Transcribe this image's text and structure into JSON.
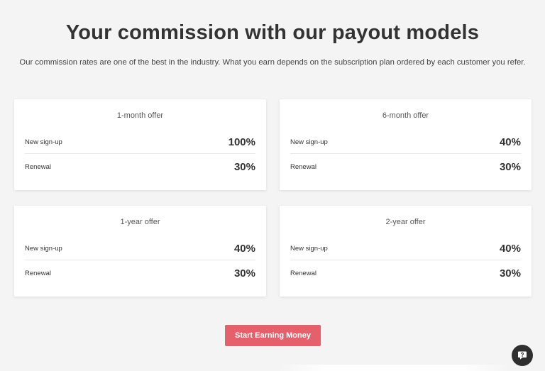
{
  "header": {
    "title": "Your commission with our payout models",
    "intro": "Our commission rates are one of the best in the industry. What you earn depends on the subscription plan ordered by each customer you refer."
  },
  "offers": [
    {
      "title": "1-month offer",
      "signup_label": "New sign-up",
      "signup_value": "100%",
      "renewal_label": "Renewal",
      "renewal_value": "30%"
    },
    {
      "title": "6-month offer",
      "signup_label": "New sign-up",
      "signup_value": "40%",
      "renewal_label": "Renewal",
      "renewal_value": "30%"
    },
    {
      "title": "1-year offer",
      "signup_label": "New sign-up",
      "signup_value": "40%",
      "renewal_label": "Renewal",
      "renewal_value": "30%"
    },
    {
      "title": "2-year offer",
      "signup_label": "New sign-up",
      "signup_value": "40%",
      "renewal_label": "Renewal",
      "renewal_value": "30%"
    }
  ],
  "cta": {
    "label": "Start Earning Money"
  },
  "chat": {
    "icon": "chat-help-icon"
  },
  "colors": {
    "accent": "#e6606b",
    "background": "#f4f4f4",
    "chat_button": "#2f2f2f"
  }
}
